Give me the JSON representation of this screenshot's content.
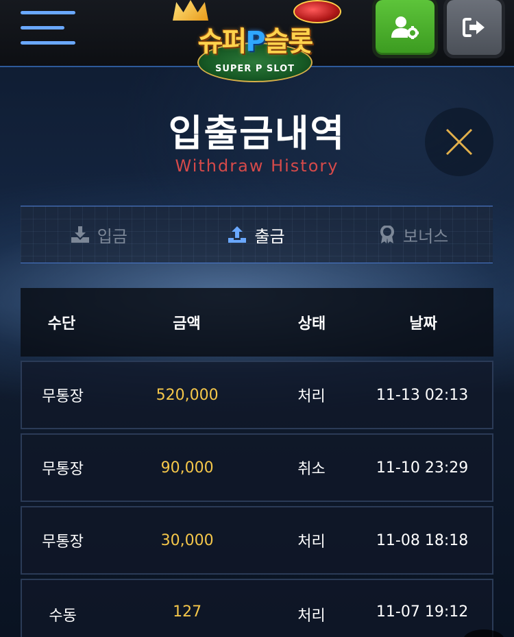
{
  "header": {
    "logo_text_left": "슈퍼",
    "logo_text_p": "P",
    "logo_text_right": "슬롯",
    "logo_subtitle": "SUPER P SLOT",
    "menu_icon": "hamburger-menu-icon",
    "profile_icon": "user-gear-icon",
    "logout_icon": "sign-out-icon",
    "colors": {
      "profile_button": "#4caf2e",
      "logout_button": "#5a5f67",
      "accent": "#6aa8ff"
    }
  },
  "page": {
    "title": "입출금내역",
    "subtitle": "Withdraw History",
    "subtitle_color": "#d64a4a",
    "close_icon": "close-icon"
  },
  "tabs": [
    {
      "label": "입금",
      "icon": "download-icon",
      "active": false
    },
    {
      "label": "출금",
      "icon": "upload-icon",
      "active": true
    },
    {
      "label": "보너스",
      "icon": "award-icon",
      "active": false
    }
  ],
  "table": {
    "headers": [
      "수단",
      "금액",
      "상태",
      "날짜"
    ],
    "rows": [
      {
        "method": "무통장",
        "amount": "520,000",
        "status": "처리",
        "date": "11-13 02:13"
      },
      {
        "method": "무통장",
        "amount": "90,000",
        "status": "취소",
        "date": "11-10 23:29"
      },
      {
        "method": "무통장",
        "amount": "30,000",
        "status": "처리",
        "date": "11-08 18:18"
      },
      {
        "method": "수동",
        "amount": "127",
        "status": "처리",
        "date": "11-07 19:12"
      }
    ],
    "amount_color": "#f5c74a"
  }
}
